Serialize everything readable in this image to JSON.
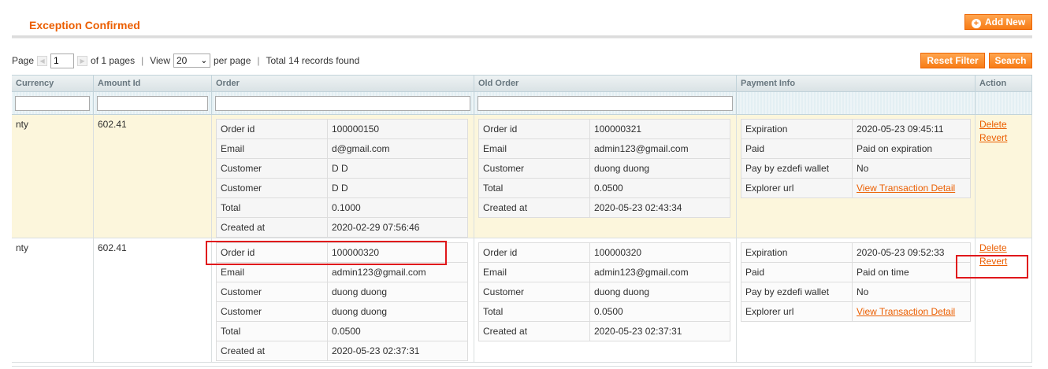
{
  "header": {
    "title": "Exception Confirmed",
    "add_new_label": "Add New"
  },
  "pager": {
    "page_label": "Page",
    "page_value": "1",
    "of_pages": "of 1 pages",
    "view_label": "View",
    "per_page_value": "20",
    "per_page_label": "per page",
    "total": "Total 14 records found"
  },
  "buttons": {
    "reset": "Reset Filter",
    "search": "Search"
  },
  "columns": [
    "Currency",
    "Amount Id",
    "Order",
    "Old Order",
    "Payment Info",
    "Action"
  ],
  "rows": [
    {
      "currency": "nty",
      "amount_id": "602.41",
      "order": [
        [
          "Order id",
          "100000150"
        ],
        [
          "Email",
          "d@gmail.com"
        ],
        [
          "Customer",
          "D D"
        ],
        [
          "Customer",
          "D D"
        ],
        [
          "Total",
          "0.1000"
        ],
        [
          "Created at",
          "2020-02-29 07:56:46"
        ]
      ],
      "old_order": [
        [
          "Order id",
          "100000321"
        ],
        [
          "Email",
          "admin123@gmail.com"
        ],
        [
          "Customer",
          "duong duong"
        ],
        [
          "Total",
          "0.0500"
        ],
        [
          "Created at",
          "2020-05-23 02:43:34"
        ]
      ],
      "payment": {
        "expiration_label": "Expiration",
        "expiration": "2020-05-23 09:45:11",
        "paid_label": "Paid",
        "paid": "Paid on expiration",
        "wallet_label": "Pay by ezdefi wallet",
        "wallet": "No",
        "explorer_label": "Explorer url",
        "explorer_link": "View Transaction Detail"
      },
      "actions": {
        "delete": "Delete",
        "revert": "Revert"
      }
    },
    {
      "currency": "nty",
      "amount_id": "602.41",
      "order": [
        [
          "Order id",
          "100000320"
        ],
        [
          "Email",
          "admin123@gmail.com"
        ],
        [
          "Customer",
          "duong duong"
        ],
        [
          "Customer",
          "duong duong"
        ],
        [
          "Total",
          "0.0500"
        ],
        [
          "Created at",
          "2020-05-23 02:37:31"
        ]
      ],
      "old_order": [
        [
          "Order id",
          "100000320"
        ],
        [
          "Email",
          "admin123@gmail.com"
        ],
        [
          "Customer",
          "duong duong"
        ],
        [
          "Total",
          "0.0500"
        ],
        [
          "Created at",
          "2020-05-23 02:37:31"
        ]
      ],
      "payment": {
        "expiration_label": "Expiration",
        "expiration": "2020-05-23 09:52:33",
        "paid_label": "Paid",
        "paid": "Paid on time",
        "wallet_label": "Pay by ezdefi wallet",
        "wallet": "No",
        "explorer_label": "Explorer url",
        "explorer_link": "View Transaction Detail"
      },
      "actions": {
        "delete": "Delete",
        "revert": "Revert"
      }
    }
  ],
  "colors": {
    "accent": "#eb5e00",
    "button": "#f77c16",
    "highlight_row": "#fcf6dc",
    "annotation_box": "#e0171b"
  }
}
